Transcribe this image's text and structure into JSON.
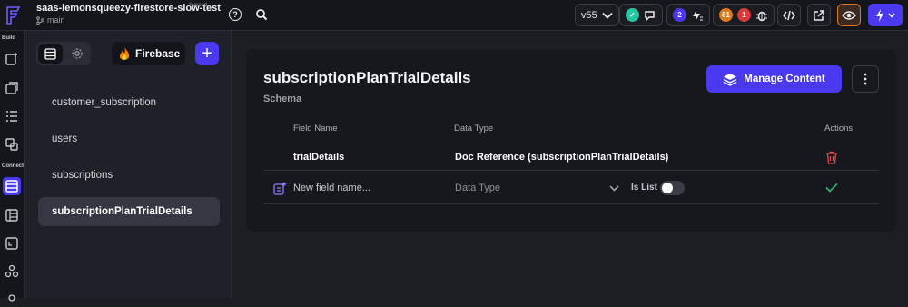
{
  "project": {
    "name": "saas-lemonsqueezy-firestore-slow-test",
    "status": "Synced",
    "branch": "main"
  },
  "topbar": {
    "version": "v55",
    "issues_count": "2",
    "warnings_count": "61",
    "errors_count": "1"
  },
  "rail": {
    "build_label": "Build",
    "connect_label": "Connect"
  },
  "panel": {
    "firebase_label": "Firebase",
    "add_label": "+",
    "collections": [
      "customer_subscription",
      "users",
      "subscriptions",
      "subscriptionPlanTrialDetails"
    ]
  },
  "schema": {
    "title": "subscriptionPlanTrialDetails",
    "subtitle": "Schema",
    "manage_label": "Manage Content",
    "headers": {
      "field_name": "Field Name",
      "data_type": "Data Type",
      "actions": "Actions"
    },
    "fields": [
      {
        "name": "trialDetails",
        "type": "Doc Reference (subscriptionPlanTrialDetails)"
      }
    ],
    "new_field": {
      "placeholder": "New field name...",
      "type_placeholder": "Data Type",
      "is_list_label": "Is List"
    }
  },
  "colors": {
    "accent": "#4b39ef",
    "delete": "#e5484d",
    "confirm": "#2bb673",
    "success": "#26c6a2",
    "warning": "#e0791a"
  }
}
